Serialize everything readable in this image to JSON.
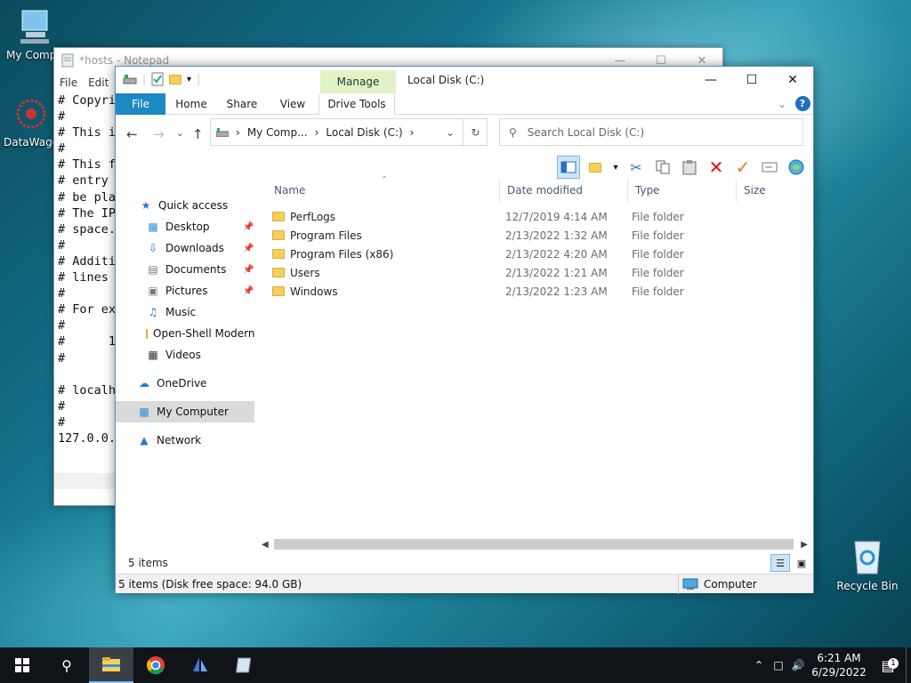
{
  "desktop": {
    "icons": [
      {
        "label": "My Compu"
      },
      {
        "label": "DataWago"
      },
      {
        "label": "Recycle Bin"
      }
    ]
  },
  "notepad": {
    "title": "*hosts - Notepad",
    "menu": [
      "File",
      "Edit"
    ],
    "lines": [
      "# Copyri",
      "#",
      "# This i",
      "#",
      "# This f",
      "# entry",
      "# be pla",
      "# The IP",
      "# space.",
      "#",
      "# Additi",
      "# lines ",
      "#",
      "# For ex",
      "#",
      "#      1",
      "#",
      "",
      "# localh",
      "#",
      "#",
      "127.0.0."
    ]
  },
  "explorer": {
    "title": "Local Disk (C:)",
    "context_tab_group": "Manage",
    "tabs": [
      "File",
      "Home",
      "Share",
      "View",
      "Drive Tools"
    ],
    "breadcrumb": [
      "My Comp...",
      "Local Disk (C:)"
    ],
    "search_placeholder": "Search Local Disk (C:)",
    "nav": [
      {
        "label": "Quick access"
      },
      {
        "label": "Desktop"
      },
      {
        "label": "Downloads"
      },
      {
        "label": "Documents"
      },
      {
        "label": "Pictures"
      },
      {
        "label": "Music"
      },
      {
        "label": "Open-Shell Modern"
      },
      {
        "label": "Videos"
      },
      {
        "label": "OneDrive"
      },
      {
        "label": "My Computer"
      },
      {
        "label": "Network"
      }
    ],
    "columns": [
      "Name",
      "Date modified",
      "Type",
      "Size"
    ],
    "rows": [
      {
        "name": "PerfLogs",
        "date": "12/7/2019 4:14 AM",
        "type": "File folder"
      },
      {
        "name": "Program Files",
        "date": "2/13/2022 1:32 AM",
        "type": "File folder"
      },
      {
        "name": "Program Files (x86)",
        "date": "2/13/2022 4:20 AM",
        "type": "File folder"
      },
      {
        "name": "Users",
        "date": "2/13/2022 1:21 AM",
        "type": "File folder"
      },
      {
        "name": "Windows",
        "date": "2/13/2022 1:23 AM",
        "type": "File folder"
      }
    ],
    "item_count": "5 items",
    "status_left": "5 items (Disk free space: 94.0 GB)",
    "status_right": "Computer"
  },
  "taskbar": {
    "time": "6:21 AM",
    "date": "6/29/2022",
    "notification_count": "1"
  },
  "colors": {
    "accent": "#1c88c4",
    "manage_tab": "#dff3c7"
  }
}
